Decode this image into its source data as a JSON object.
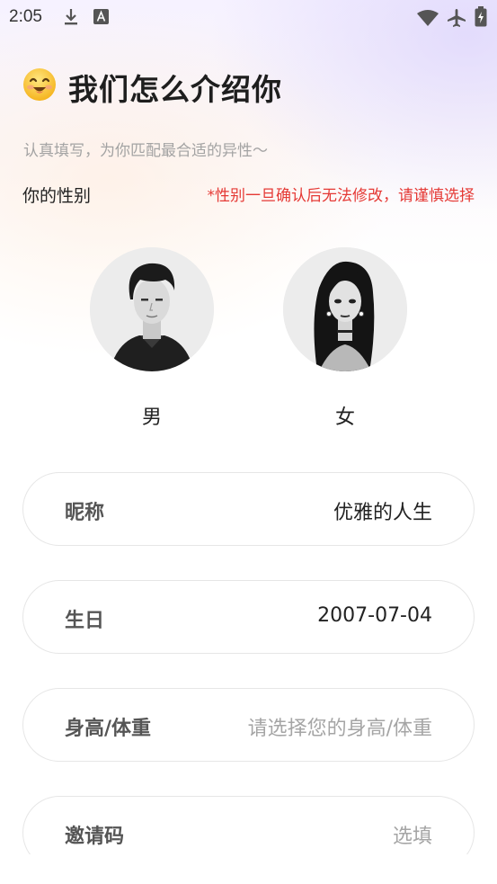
{
  "status_bar": {
    "time": "2:05",
    "left_icons": [
      "download-icon",
      "font-a-icon"
    ],
    "right_icons": [
      "wifi-icon",
      "airplane-icon",
      "battery-icon"
    ]
  },
  "header": {
    "emoji": "smiling-face-emoji",
    "title": "我们怎么介绍你",
    "subtitle": "认真填写，为你匹配最合适的异性～"
  },
  "gender": {
    "label": "你的性别",
    "warning": "*性别一旦确认后无法修改，请谨慎选择",
    "options": [
      {
        "label": "男",
        "icon": "male-avatar"
      },
      {
        "label": "女",
        "icon": "female-avatar"
      }
    ]
  },
  "fields": [
    {
      "label": "昵称",
      "value": "优雅的人生",
      "is_placeholder": false
    },
    {
      "label": "生日",
      "value": "2007-07-04",
      "is_placeholder": false
    },
    {
      "label": "身高/体重",
      "value": "请选择您的身高/体重",
      "is_placeholder": true
    },
    {
      "label": "邀请码",
      "value": "选填",
      "is_placeholder": true
    }
  ],
  "colors": {
    "warning": "#e53935",
    "placeholder": "#a5a5a5",
    "field_border": "#e6e6e6"
  }
}
